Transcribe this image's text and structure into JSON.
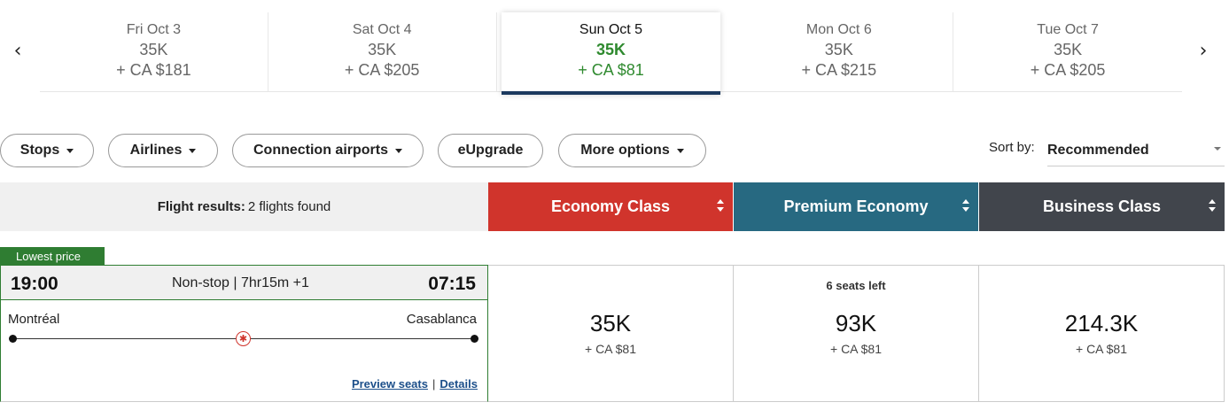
{
  "date_nav": {
    "prev_icon": "chevron-left-icon",
    "next_icon": "chevron-right-icon",
    "dates": [
      {
        "day": "Fri Oct 3",
        "points": "35K",
        "cash": "+ CA $181"
      },
      {
        "day": "Sat Oct 4",
        "points": "35K",
        "cash": "+ CA $205"
      },
      {
        "day": "Sun Oct 5",
        "points": "35K",
        "cash": "+ CA $81"
      },
      {
        "day": "Mon Oct 6",
        "points": "35K",
        "cash": "+ CA $215"
      },
      {
        "day": "Tue Oct 7",
        "points": "35K",
        "cash": "+ CA $205"
      }
    ],
    "selected_index": 2,
    "selected_color": "#2f8a2f",
    "selected_underline_color": "#1c3a5f"
  },
  "filters": {
    "stops": "Stops",
    "airlines": "Airlines",
    "connection_airports": "Connection airports",
    "eupgrade": "eUpgrade",
    "more_options": "More options"
  },
  "sort": {
    "label": "Sort by:",
    "value": "Recommended"
  },
  "results_header": {
    "label": "Flight results:",
    "count_text": "2 flights found"
  },
  "cabins": {
    "economy": {
      "label": "Economy Class",
      "color": "#d0342c"
    },
    "premium": {
      "label": "Premium Economy",
      "color": "#276981"
    },
    "business": {
      "label": "Business Class",
      "color": "#41454c"
    }
  },
  "flight": {
    "badge": "Lowest price",
    "departure_time": "19:00",
    "arrival_time": "07:15",
    "duration": "Non-stop | 7hr15m +1",
    "origin": "Montréal",
    "destination": "Casablanca",
    "airline_icon": "maple-leaf-icon",
    "preview_seats": "Preview seats",
    "link_separator": "|",
    "details": "Details",
    "fares": {
      "economy": {
        "points": "35K",
        "cash": "+ CA $81"
      },
      "premium": {
        "seats_left": "6 seats left",
        "points": "93K",
        "cash": "+ CA $81"
      },
      "business": {
        "points": "214.3K",
        "cash": "+ CA $81"
      }
    }
  }
}
